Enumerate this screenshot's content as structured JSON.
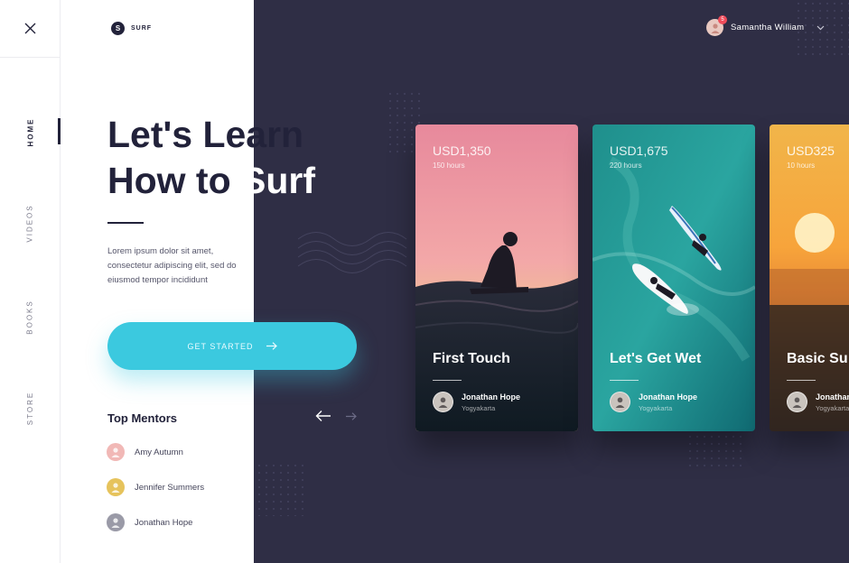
{
  "brand": {
    "logo_letter": "S",
    "name": "SURF"
  },
  "rail": {
    "items": [
      {
        "label": "HOME",
        "active": true
      },
      {
        "label": "VIDEOS",
        "active": false
      },
      {
        "label": "BOOKS",
        "active": false
      },
      {
        "label": "STORE",
        "active": false
      }
    ]
  },
  "hero": {
    "headline_line1": "Let's Learn",
    "headline_line2_dark": "How to ",
    "headline_line2_light": "Surf",
    "description": "Lorem ipsum dolor sit amet, consectetur adipiscing elit, sed do eiusmod tempor incididunt",
    "cta_label": "GET STARTED"
  },
  "mentors": {
    "title": "Top Mentors",
    "items": [
      {
        "name": "Amy Autumn",
        "color": "#f1b8b6"
      },
      {
        "name": "Jennifer Summers",
        "color": "#e6c35c"
      },
      {
        "name": "Jonathan Hope",
        "color": "#9a9aa7"
      }
    ]
  },
  "user": {
    "name": "Samantha William",
    "notifications": "5"
  },
  "cards": [
    {
      "price": "USD1,350",
      "hours": "150 hours",
      "title": "First Touch",
      "instructor": "Jonathan Hope",
      "location": "Yogyakarta",
      "theme": "sunset-pink"
    },
    {
      "price": "USD1,675",
      "hours": "220 hours",
      "title": "Let's Get Wet",
      "instructor": "Jonathan Hope",
      "location": "Yogyakarta",
      "theme": "ocean-teal"
    },
    {
      "price": "USD325",
      "hours": "10 hours",
      "title": "Basic Su",
      "instructor": "Jonathan Hope",
      "location": "Yogyakarta",
      "theme": "sunset-orange"
    }
  ],
  "colors": {
    "dark_bg": "#2f2e45",
    "accent": "#3bc9df",
    "text_dark": "#22223a"
  }
}
